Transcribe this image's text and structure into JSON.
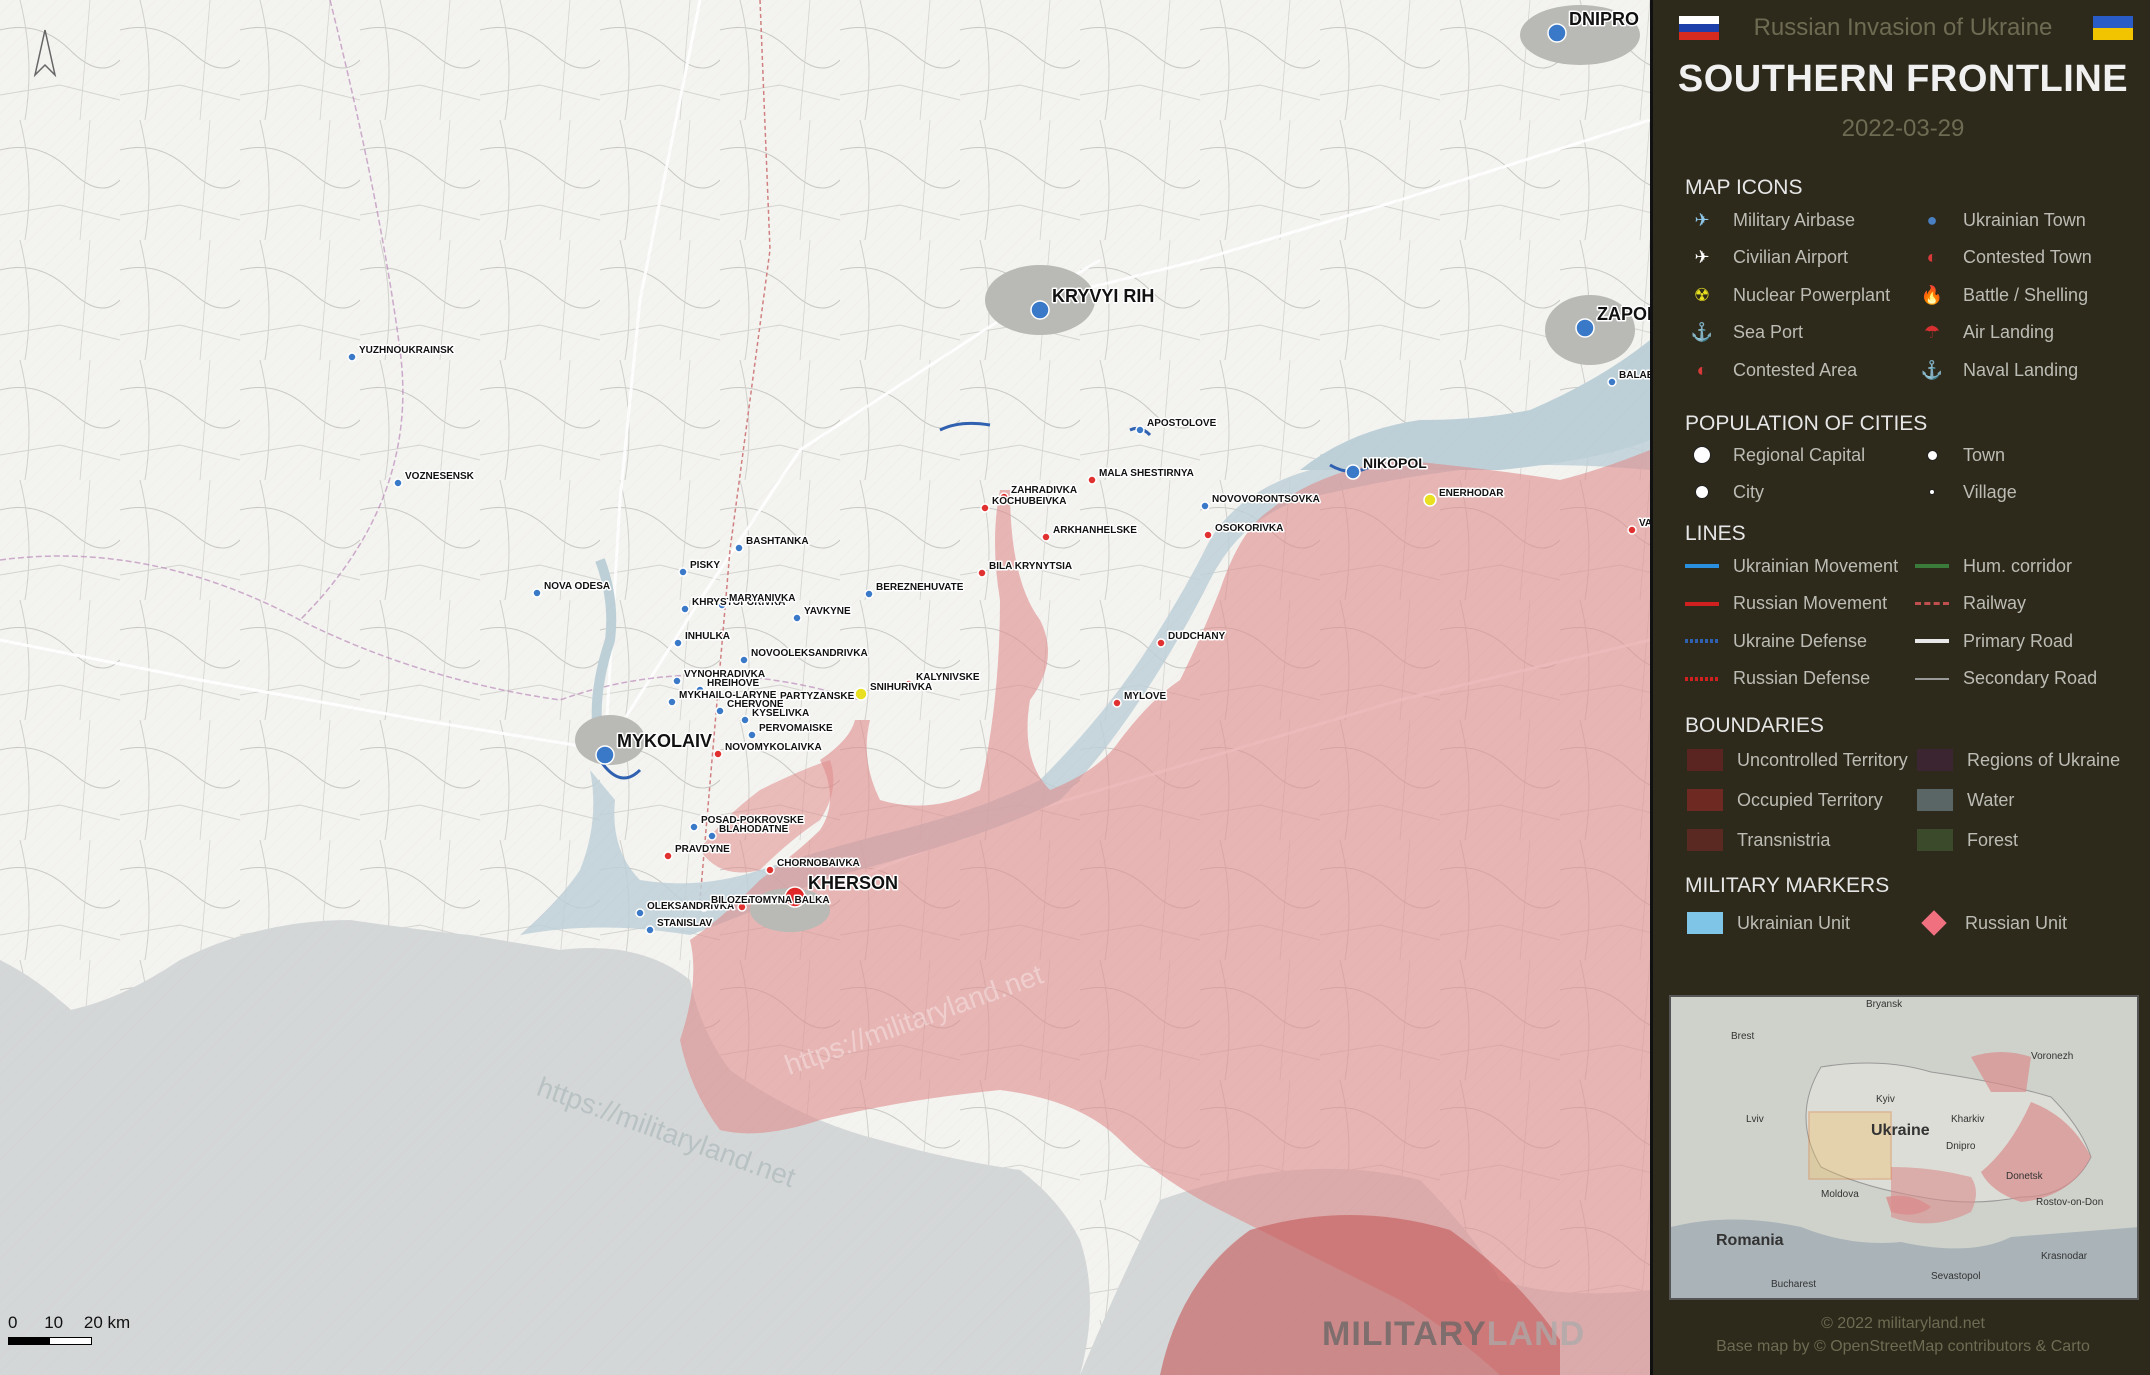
{
  "header": {
    "subtitle": "Russian Invasion of Ukraine",
    "title": "SOUTHERN FRONTLINE",
    "date": "2022-03-29",
    "flag_left": [
      "#ffffff",
      "#1c3faa",
      "#d52b1e"
    ],
    "flag_right": [
      "#2a5cc8",
      "#f2c400"
    ]
  },
  "legend": {
    "map_icons_title": "MAP ICONS",
    "map_icons": [
      {
        "label": "Military Airbase",
        "icon": "jet-icon",
        "glyph": "✈",
        "color": "#8fc7e8"
      },
      {
        "label": "Ukrainian Town",
        "icon": "blue-dot-icon",
        "glyph": "●",
        "color": "#4a7fc2"
      },
      {
        "label": "Civilian Airport",
        "icon": "plane-icon",
        "glyph": "✈",
        "color": "#ffffff"
      },
      {
        "label": "Contested Town",
        "icon": "half-dot-icon",
        "glyph": "◐",
        "color": "#d83a3a"
      },
      {
        "label": "Nuclear Powerplant",
        "icon": "radiation-icon",
        "glyph": "☢",
        "color": "#e8e020"
      },
      {
        "label": "Battle / Shelling",
        "icon": "fire-icon",
        "glyph": "🔥",
        "color": "#e07020"
      },
      {
        "label": "Sea Port",
        "icon": "anchor-icon",
        "glyph": "⚓",
        "color": "#dddddd"
      },
      {
        "label": "Air Landing",
        "icon": "parachute-icon",
        "glyph": "☂",
        "color": "#d83030"
      },
      {
        "label": "Contested Area",
        "icon": "contested-area-icon",
        "glyph": "◐",
        "color": "#d83a3a"
      },
      {
        "label": "Naval Landing",
        "icon": "red-anchor-icon",
        "glyph": "⚓",
        "color": "#d83030"
      }
    ],
    "population_title": "POPULATION OF CITIES",
    "population": [
      {
        "label": "Regional Capital",
        "size": "large"
      },
      {
        "label": "Town",
        "size": "small"
      },
      {
        "label": "City",
        "size": "medium"
      },
      {
        "label": "Village",
        "size": "tiny"
      }
    ],
    "lines_title": "LINES",
    "lines": [
      {
        "label": "Ukrainian Movement",
        "color": "#2b8fe0",
        "style": "arrow"
      },
      {
        "label": "Hum. corridor",
        "color": "#3a7a3a",
        "style": "solid"
      },
      {
        "label": "Russian Movement",
        "color": "#d02020",
        "style": "arrow"
      },
      {
        "label": "Railway",
        "color": "#c05050",
        "style": "dashed"
      },
      {
        "label": "Ukraine Defense",
        "color": "#3060b0",
        "style": "teeth"
      },
      {
        "label": "Primary Road",
        "color": "#e8e8e8",
        "style": "solid"
      },
      {
        "label": "Russian Defense",
        "color": "#d02020",
        "style": "teeth"
      },
      {
        "label": "Secondary Road",
        "color": "#999999",
        "style": "thin"
      }
    ],
    "boundaries_title": "BOUNDARIES",
    "boundaries": [
      {
        "label": "Uncontrolled Territory",
        "color": "#5a2520"
      },
      {
        "label": "Regions of Ukraine",
        "color": "#3a2530"
      },
      {
        "label": "Occupied Territory",
        "color": "#6e2a22"
      },
      {
        "label": "Water",
        "color": "#5a6666"
      },
      {
        "label": "Transnistria",
        "color": "#5a2a22"
      },
      {
        "label": "Forest",
        "color": "#3a4a2a"
      }
    ],
    "markers_title": "MILITARY MARKERS",
    "markers": [
      {
        "label": "Ukrainian Unit",
        "color": "#7ec5e8",
        "shape": "rect"
      },
      {
        "label": "Russian Unit",
        "color": "#f07080",
        "shape": "diamond"
      }
    ]
  },
  "inset": {
    "labels": [
      "Bryansk",
      "Brest",
      "Voronezh",
      "Lviv",
      "Kyiv",
      "Kharkiv",
      "Ukraine",
      "Dnipro",
      "Donetsk",
      "Moldova",
      "Rostov-on-Don",
      "Romania",
      "Krasnodar",
      "Sevastopol",
      "Bucharest"
    ]
  },
  "map": {
    "cities": [
      {
        "name": "DNIPRO",
        "type": "capital"
      },
      {
        "name": "KRYVYI RIH",
        "type": "capital"
      },
      {
        "name": "ZAPORIZHZHIA",
        "type": "capital"
      },
      {
        "name": "MYKOLAIV",
        "type": "capital"
      },
      {
        "name": "KHERSON",
        "type": "capital-occupied"
      },
      {
        "name": "NIKOPOL",
        "type": "city"
      },
      {
        "name": "ENERHODAR",
        "type": "contested"
      },
      {
        "name": "YUZHNOUKRAINSK",
        "type": "town"
      },
      {
        "name": "VOZNESENSK",
        "type": "town"
      },
      {
        "name": "BALABYNE",
        "type": "town"
      },
      {
        "name": "APOSTOLOVE",
        "type": "town"
      },
      {
        "name": "MALA SHESTIRNYA",
        "type": "occupied"
      },
      {
        "name": "ZAHRADIVKA",
        "type": "occupied"
      },
      {
        "name": "KOCHUBEIVKA",
        "type": "occupied"
      },
      {
        "name": "ARKHANHELSKE",
        "type": "occupied"
      },
      {
        "name": "NOVOVORONTSOVKA",
        "type": "town"
      },
      {
        "name": "OSOKORIVKA",
        "type": "occupied"
      },
      {
        "name": "VASYLIVKA",
        "type": "occupied"
      },
      {
        "name": "BILA KRYNYTSIA",
        "type": "occupied"
      },
      {
        "name": "BASHTANKA",
        "type": "town"
      },
      {
        "name": "PISKY",
        "type": "town"
      },
      {
        "name": "NOVA ODESA",
        "type": "town"
      },
      {
        "name": "KHRYSTOFORIVKA",
        "type": "town"
      },
      {
        "name": "MARYANIVKA",
        "type": "town"
      },
      {
        "name": "BEREZNEHUVATE",
        "type": "town"
      },
      {
        "name": "YAVKYNE",
        "type": "town"
      },
      {
        "name": "INHULKA",
        "type": "town"
      },
      {
        "name": "NOVOOLEKSANDRIVKA",
        "type": "town"
      },
      {
        "name": "DUDCHANY",
        "type": "occupied"
      },
      {
        "name": "VYNOHRADIVKA",
        "type": "town"
      },
      {
        "name": "KALYNIVSKE",
        "type": "occupied"
      },
      {
        "name": "HREIHOVE",
        "type": "town"
      },
      {
        "name": "MYKHAILO-LARYNE",
        "type": "town"
      },
      {
        "name": "PARTYZANSKE",
        "type": "town"
      },
      {
        "name": "CHERVONE",
        "type": "town"
      },
      {
        "name": "SNIHURIVKA",
        "type": "contested"
      },
      {
        "name": "MYLOVE",
        "type": "occupied"
      },
      {
        "name": "KYSELIVKA",
        "type": "town"
      },
      {
        "name": "PERVOMAISKE",
        "type": "town"
      },
      {
        "name": "NOVOMYKOLAIVKA",
        "type": "occupied"
      },
      {
        "name": "POSAD-POKROVSKE",
        "type": "town"
      },
      {
        "name": "BLAHODATNE",
        "type": "town"
      },
      {
        "name": "PRAVDYNE",
        "type": "occupied"
      },
      {
        "name": "CHORNOBAIVKA",
        "type": "occupied"
      },
      {
        "name": "OLEKSANDRIVKA",
        "type": "town"
      },
      {
        "name": "BILOZERKA",
        "type": "occupied"
      },
      {
        "name": "STANISLAV",
        "type": "town"
      },
      {
        "name": "TOMYNA BALKA",
        "type": "occupied"
      }
    ],
    "scale": {
      "labels": [
        "0",
        "10",
        "20 km"
      ]
    },
    "watermark": "https://militaryland.net",
    "logo_left": "MILITARY",
    "logo_right": "LAND"
  },
  "footer": {
    "copyright": "© 2022 militaryland.net",
    "basemap": "Base map by © OpenStreetMap contributors & Carto"
  }
}
